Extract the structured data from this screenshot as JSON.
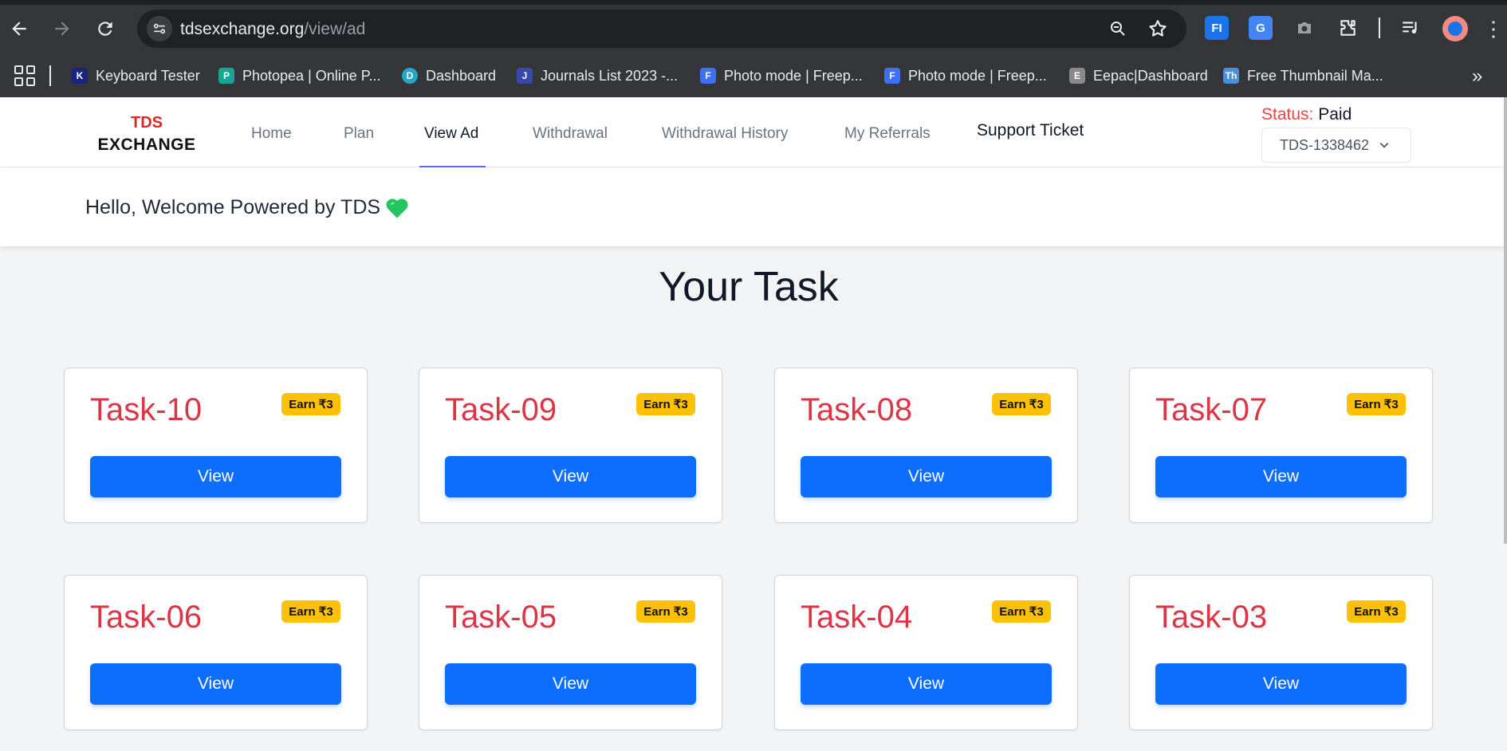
{
  "browser": {
    "url_domain": "tdsexchange.org",
    "url_path": "/view/ad",
    "bookmarks": [
      {
        "label": "Keyboard Tester",
        "fav_text": "K",
        "fav_color": "#1a237e"
      },
      {
        "label": "Photopea | Online P...",
        "fav_text": "P",
        "fav_color": "#18a497"
      },
      {
        "label": "Dashboard",
        "fav_text": "D",
        "fav_color": "#2aa5c9"
      },
      {
        "label": "Journals List 2023 -...",
        "fav_text": "J",
        "fav_color": "#3949ab"
      },
      {
        "label": "Photo mode | Freep...",
        "fav_text": "F",
        "fav_color": "#3f6ff5"
      },
      {
        "label": "Photo mode | Freep...",
        "fav_text": "F",
        "fav_color": "#3f6ff5"
      },
      {
        "label": "Eepac|Dashboard",
        "fav_text": "E",
        "fav_color": "#8a8a8a"
      },
      {
        "label": "Free Thumbnail Ma...",
        "fav_text": "Th",
        "fav_color": "#4a90d9"
      }
    ]
  },
  "navbar": {
    "brand_line1": "TDS",
    "brand_line2": "EXCHANGE",
    "links": [
      "Home",
      "Plan",
      "View Ad",
      "Withdrawal",
      "Withdrawal History",
      "My Referrals",
      "Support Ticket"
    ],
    "status_label": "Status:",
    "status_value": "Paid",
    "user_id": "TDS-1338462"
  },
  "welcome": {
    "text": "Hello, Welcome Powered by TDS"
  },
  "page_title": "Your Task",
  "tasks": [
    {
      "title": "Task-10",
      "badge": "Earn ₹3",
      "button": "View"
    },
    {
      "title": "Task-09",
      "badge": "Earn ₹3",
      "button": "View"
    },
    {
      "title": "Task-08",
      "badge": "Earn ₹3",
      "button": "View"
    },
    {
      "title": "Task-07",
      "badge": "Earn ₹3",
      "button": "View"
    },
    {
      "title": "Task-06",
      "badge": "Earn ₹3",
      "button": "View"
    },
    {
      "title": "Task-05",
      "badge": "Earn ₹3",
      "button": "View"
    },
    {
      "title": "Task-04",
      "badge": "Earn ₹3",
      "button": "View"
    },
    {
      "title": "Task-03",
      "badge": "Earn ₹3",
      "button": "View"
    }
  ],
  "colors": {
    "brand_red": "#dc2626",
    "task_title": "#dc3545",
    "badge": "#ffc107",
    "view_button": "#0d6efd",
    "active_underline": "#6366f1"
  }
}
